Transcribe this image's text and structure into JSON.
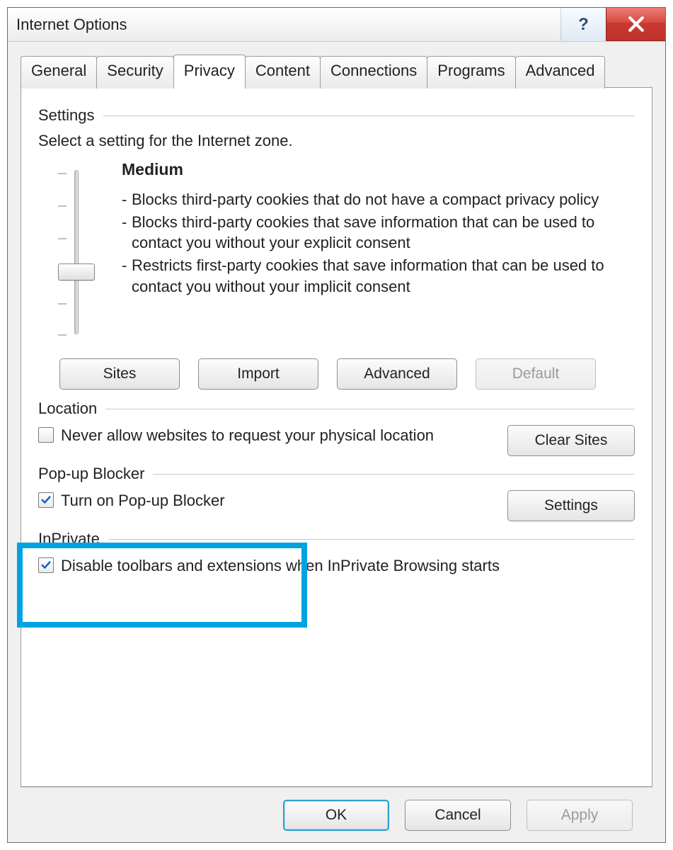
{
  "window": {
    "title": "Internet Options"
  },
  "tabs": [
    "General",
    "Security",
    "Privacy",
    "Content",
    "Connections",
    "Programs",
    "Advanced"
  ],
  "active_tab": "Privacy",
  "settings": {
    "header": "Settings",
    "instruction": "Select a setting for the Internet zone.",
    "level": "Medium",
    "bullets": [
      "Blocks third-party cookies that do not have a compact privacy policy",
      "Blocks third-party cookies that save information that can be used to contact you without your explicit consent",
      "Restricts first-party cookies that save information that can be used to contact you without your implicit consent"
    ],
    "buttons": {
      "sites": "Sites",
      "import": "Import",
      "advanced": "Advanced",
      "default": "Default"
    }
  },
  "location": {
    "header": "Location",
    "checkbox": "Never allow websites to request your physical location",
    "checked": false,
    "button": "Clear Sites"
  },
  "popup": {
    "header": "Pop-up Blocker",
    "checkbox": "Turn on Pop-up Blocker",
    "checked": true,
    "button": "Settings"
  },
  "inprivate": {
    "header": "InPrivate",
    "checkbox": "Disable toolbars and extensions when InPrivate Browsing starts",
    "checked": true
  },
  "footer": {
    "ok": "OK",
    "cancel": "Cancel",
    "apply": "Apply"
  }
}
